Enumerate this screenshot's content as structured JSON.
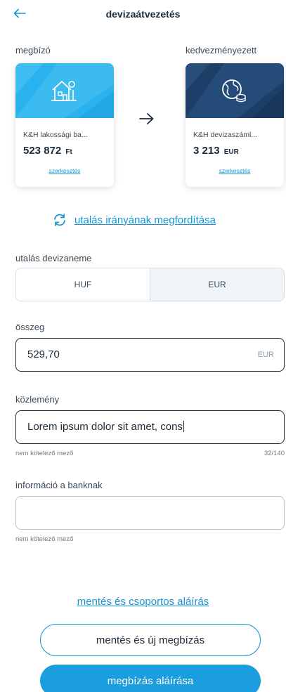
{
  "header": {
    "title": "devizaátvezetés",
    "back_icon": "arrow-left-icon"
  },
  "payer": {
    "label": "megbízó",
    "account_name": "K&H lakossági ba...",
    "balance": "523 872",
    "currency": "Ft",
    "edit_label": "szerkesztés",
    "icon": "house-icon",
    "color": "#29b2ee"
  },
  "beneficiary": {
    "label": "kedvezményezett",
    "account_name": "K&H devizaszáml...",
    "balance": "3 213",
    "currency": "EUR",
    "edit_label": "szerkesztés",
    "icon": "globe-coins-icon",
    "color": "#1d3e66"
  },
  "swap": {
    "label": "utalás irányának megfordítása",
    "icon": "refresh-icon"
  },
  "currency_select": {
    "label": "utalás devizaneme",
    "options": [
      "HUF",
      "EUR"
    ],
    "selected": "EUR"
  },
  "amount": {
    "label": "összeg",
    "value": "529,70",
    "currency": "EUR"
  },
  "message": {
    "label": "közlemény",
    "value": "Lorem ipsum dolor sit amet, cons",
    "hint": "nem kötelező mező",
    "counter": "32/140"
  },
  "bank_info": {
    "label": "információ a banknak",
    "value": "",
    "hint": "nem kötelező mező"
  },
  "actions": {
    "group_sign": "mentés és csoportos aláírás",
    "save_new": "mentés és új megbízás",
    "sign": "megbízás aláírása"
  },
  "colors": {
    "accent": "#1596d4",
    "primary_button": "#1a9ee0",
    "text": "#1b2b3a"
  }
}
